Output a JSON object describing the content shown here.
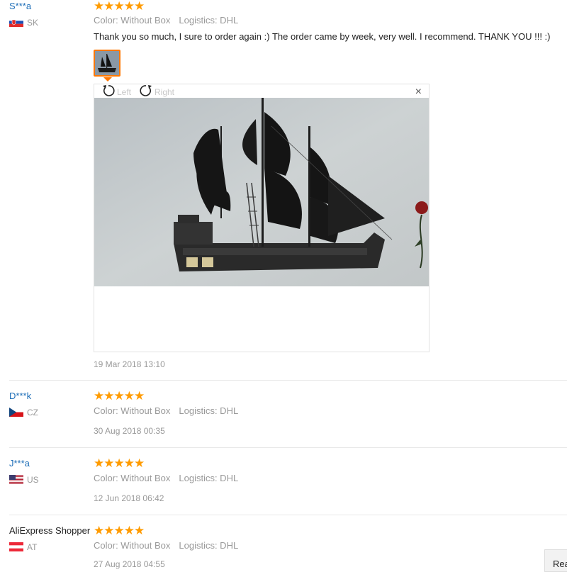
{
  "reviews": [
    {
      "user": "S***a",
      "country": "SK",
      "stars": "★★★★★",
      "color_label": "Color: Without Box",
      "logistics_label": "Logistics: DHL",
      "comment": "Thank you so much, I sure to order again :) The order came by week, very well. I recommend. THANK YOU !!! :)",
      "date": "19 Mar 2018 13:10"
    },
    {
      "user": "D***k",
      "country": "CZ",
      "stars": "★★★★★",
      "color_label": "Color: Without Box",
      "logistics_label": "Logistics: DHL",
      "date": "30 Aug 2018 00:35"
    },
    {
      "user": "J***a",
      "country": "US",
      "stars": "★★★★★",
      "color_label": "Color: Without Box",
      "logistics_label": "Logistics: DHL",
      "date": "12 Jun 2018 06:42"
    },
    {
      "user": "AliExpress Shopper",
      "country": "AT",
      "stars": "★★★★★",
      "color_label": "Color: Without Box",
      "logistics_label": "Logistics: DHL",
      "date": "27 Aug 2018 04:55"
    }
  ],
  "viewer": {
    "rotate_left": "Left",
    "rotate_right": "Right",
    "close": "×"
  },
  "read_more": "Read"
}
